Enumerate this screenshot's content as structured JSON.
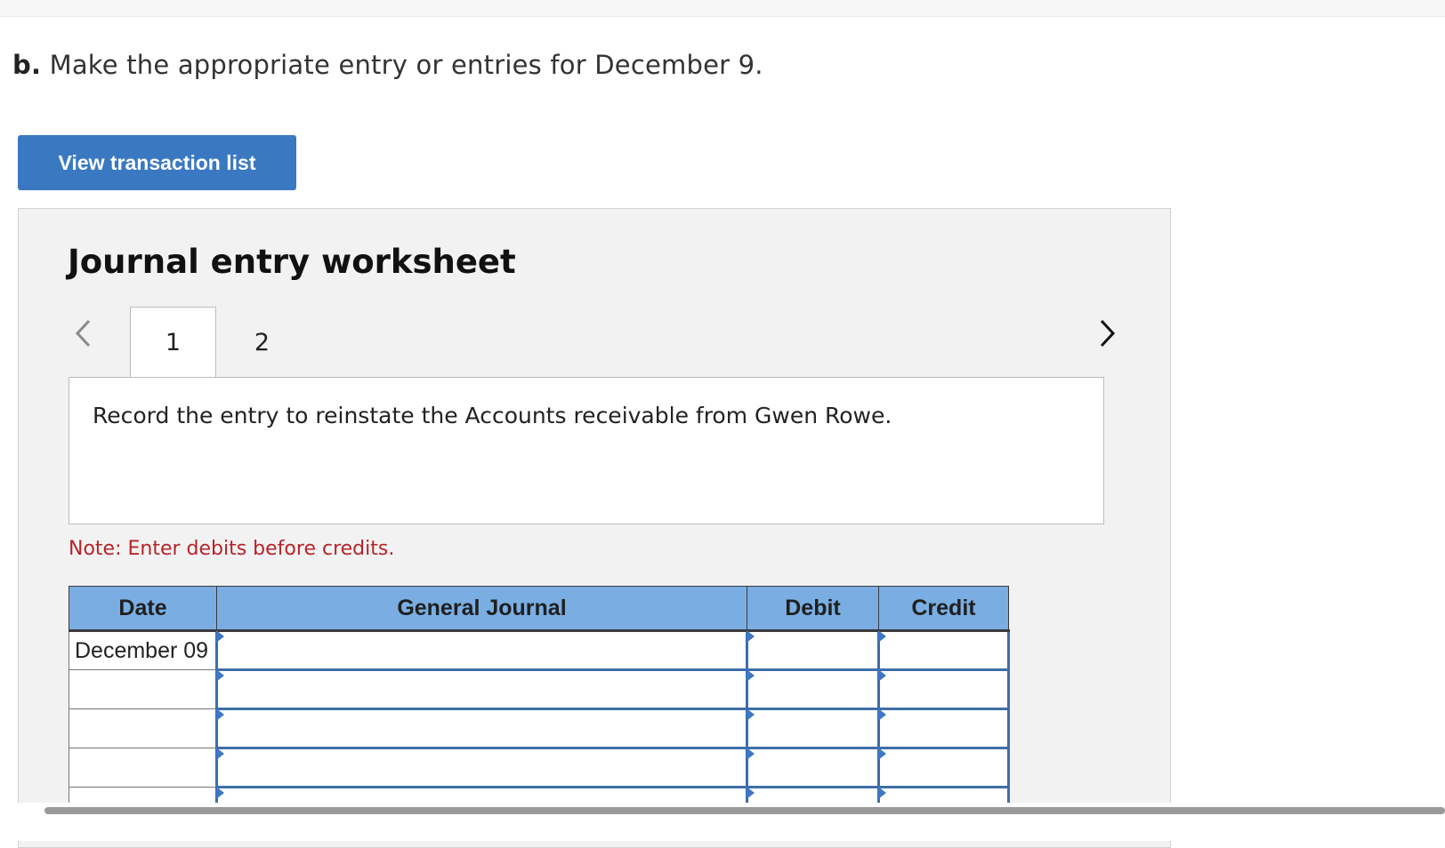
{
  "question": {
    "label": "b.",
    "text": "Make the appropriate entry or entries for December 9."
  },
  "buttons": {
    "view_transaction_list": "View transaction list"
  },
  "worksheet": {
    "title": "Journal entry worksheet",
    "tabs": [
      {
        "label": "1",
        "active": true
      },
      {
        "label": "2",
        "active": false
      }
    ],
    "prompt": "Record the entry to reinstate the Accounts receivable from Gwen Rowe.",
    "note": "Note: Enter debits before credits.",
    "table": {
      "headers": [
        "Date",
        "General Journal",
        "Debit",
        "Credit"
      ],
      "rows": [
        {
          "date": "December 09",
          "account": "",
          "debit": "",
          "credit": ""
        },
        {
          "date": "",
          "account": "",
          "debit": "",
          "credit": ""
        },
        {
          "date": "",
          "account": "",
          "debit": "",
          "credit": ""
        },
        {
          "date": "",
          "account": "",
          "debit": "",
          "credit": ""
        },
        {
          "date": "",
          "account": "",
          "debit": "",
          "credit": ""
        }
      ]
    }
  },
  "colors": {
    "button_bg": "#3a78c2",
    "header_bg": "#7aaee3",
    "note_red": "#b6242a",
    "input_border": "#3e6ea8"
  }
}
